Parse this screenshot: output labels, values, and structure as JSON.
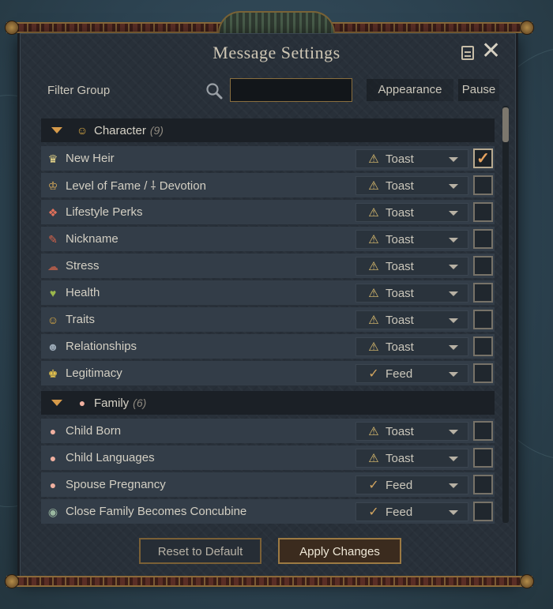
{
  "window": {
    "title": "Message Settings"
  },
  "toolbar": {
    "filter_label": "Filter Group",
    "search_placeholder": "",
    "search_value": "",
    "col_appearance": "Appearance",
    "col_pause": "Pause"
  },
  "groups": [
    {
      "title": "Character",
      "count": "(9)",
      "icon": "masks-icon",
      "items": [
        {
          "label": "New Heir",
          "icon": "crown-heir-icon",
          "glyph": "♛",
          "appearance": "Toast",
          "appearance_icon": "⚠",
          "paused": true
        },
        {
          "label": "Level of Fame / ⸸ Devotion",
          "icon": "fame-icon",
          "glyph": "♔",
          "appearance": "Toast",
          "appearance_icon": "⚠",
          "paused": false
        },
        {
          "label": "Lifestyle Perks",
          "icon": "perk-icon",
          "glyph": "❖",
          "appearance": "Toast",
          "appearance_icon": "⚠",
          "paused": false
        },
        {
          "label": "Nickname",
          "icon": "nickname-icon",
          "glyph": "✎",
          "appearance": "Toast",
          "appearance_icon": "⚠",
          "paused": false
        },
        {
          "label": "Stress",
          "icon": "stress-icon",
          "glyph": "☁",
          "appearance": "Toast",
          "appearance_icon": "⚠",
          "paused": false
        },
        {
          "label": "Health",
          "icon": "heart-icon",
          "glyph": "♥",
          "appearance": "Toast",
          "appearance_icon": "⚠",
          "paused": false
        },
        {
          "label": "Traits",
          "icon": "traits-icon",
          "glyph": "☺",
          "appearance": "Toast",
          "appearance_icon": "⚠",
          "paused": false
        },
        {
          "label": "Relationships",
          "icon": "relationship-icon",
          "glyph": "☻",
          "appearance": "Toast",
          "appearance_icon": "⚠",
          "paused": false
        },
        {
          "label": "Legitimacy",
          "icon": "legitimacy-icon",
          "glyph": "♚",
          "appearance": "Feed",
          "appearance_icon": "✓",
          "paused": false
        }
      ]
    },
    {
      "title": "Family",
      "count": "(6)",
      "icon": "baby-icon",
      "items": [
        {
          "label": "Child Born",
          "icon": "baby-icon",
          "glyph": "●",
          "appearance": "Toast",
          "appearance_icon": "⚠",
          "paused": false
        },
        {
          "label": "Child Languages",
          "icon": "baby-icon",
          "glyph": "●",
          "appearance": "Toast",
          "appearance_icon": "⚠",
          "paused": false
        },
        {
          "label": "Spouse Pregnancy",
          "icon": "baby-icon",
          "glyph": "●",
          "appearance": "Feed",
          "appearance_icon": "✓",
          "paused": false
        },
        {
          "label": "Close Family Becomes Concubine",
          "icon": "concubine-icon",
          "glyph": "◉",
          "appearance": "Feed",
          "appearance_icon": "✓",
          "paused": false
        }
      ]
    }
  ],
  "buttons": {
    "reset": "Reset to Default",
    "apply": "Apply Changes"
  },
  "colors": {
    "accent": "#d69a4a",
    "panel": "#283039",
    "row": "#333d48",
    "checkmark": "#e7a35f"
  }
}
